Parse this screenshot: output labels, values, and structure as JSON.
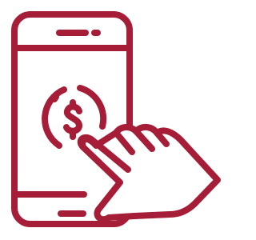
{
  "colors": {
    "stroke": "#a51d36",
    "background": "#ffffff"
  },
  "icon": {
    "name": "mobile-payment-icon",
    "symbol": "$"
  }
}
